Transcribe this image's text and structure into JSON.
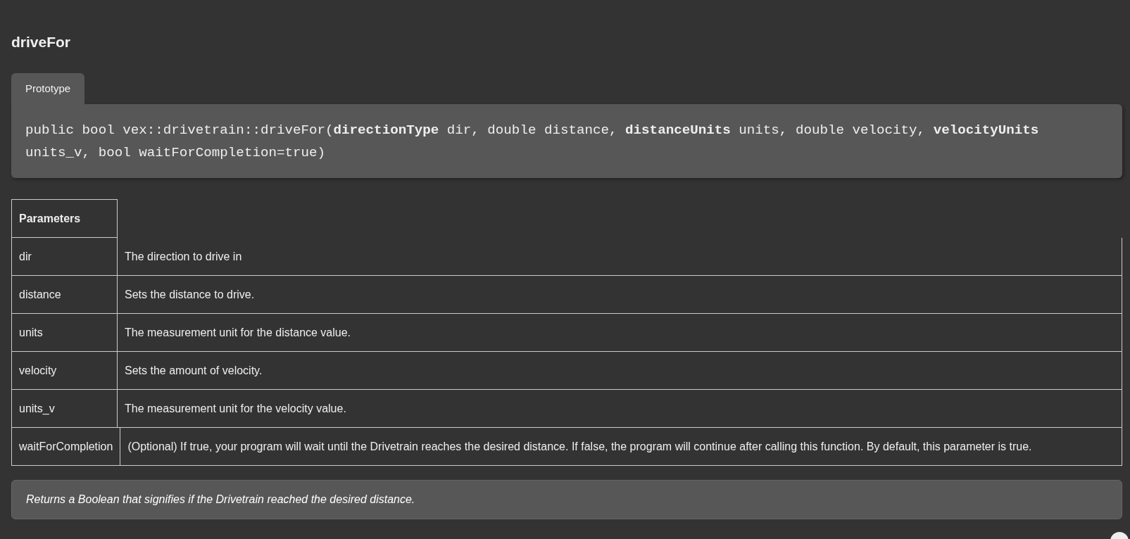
{
  "title": "driveFor",
  "tabs": [
    {
      "label": "Prototype",
      "selected": true
    }
  ],
  "prototype": "public bool vex::drivetrain::driveFor(**directionType** dir, double distance, **distanceUnits** units, double velocity, **velocityUnits** units_v, bool waitForCompletion=true)",
  "parameters": {
    "heading": "Parameters",
    "rows": [
      {
        "name": "dir",
        "description": "The direction to drive in"
      },
      {
        "name": "distance",
        "description": "Sets the distance to drive."
      },
      {
        "name": "units",
        "description": "The measurement unit for the distance value."
      },
      {
        "name": "velocity",
        "description": "Sets the amount of velocity."
      },
      {
        "name": "units_v",
        "description": "The measurement unit for the velocity value."
      },
      {
        "name": "waitForCompletion",
        "description": "(Optional) If true, your program will wait until the Drivetrain reaches the desired distance. If false, the program will continue after calling this function. By default, this parameter is true."
      }
    ]
  },
  "returns": "Returns a Boolean that signifies if the Drivetrain reached the desired distance."
}
